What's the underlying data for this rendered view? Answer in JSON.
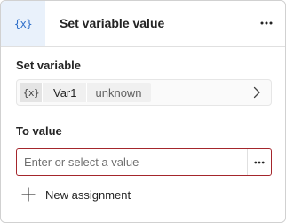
{
  "header": {
    "icon_text": "{x}",
    "icon_name": "variable-icon",
    "title": "Set variable value",
    "menu_icon": "more-horizontal-icon"
  },
  "set_variable": {
    "label": "Set variable",
    "chip_icon_text": "{x}",
    "variable_name": "Var1",
    "variable_type": "unknown",
    "chevron_icon": "chevron-right-icon"
  },
  "to_value": {
    "label": "To value",
    "placeholder": "Enter or select a value",
    "value": "",
    "more_icon": "more-horizontal-icon"
  },
  "actions": {
    "new_assignment_label": "New assignment",
    "plus_icon": "plus-icon"
  },
  "colors": {
    "accent_blue": "#2f6fc9",
    "header_icon_bg": "#e9f1fb",
    "error_border": "#a4262c"
  }
}
